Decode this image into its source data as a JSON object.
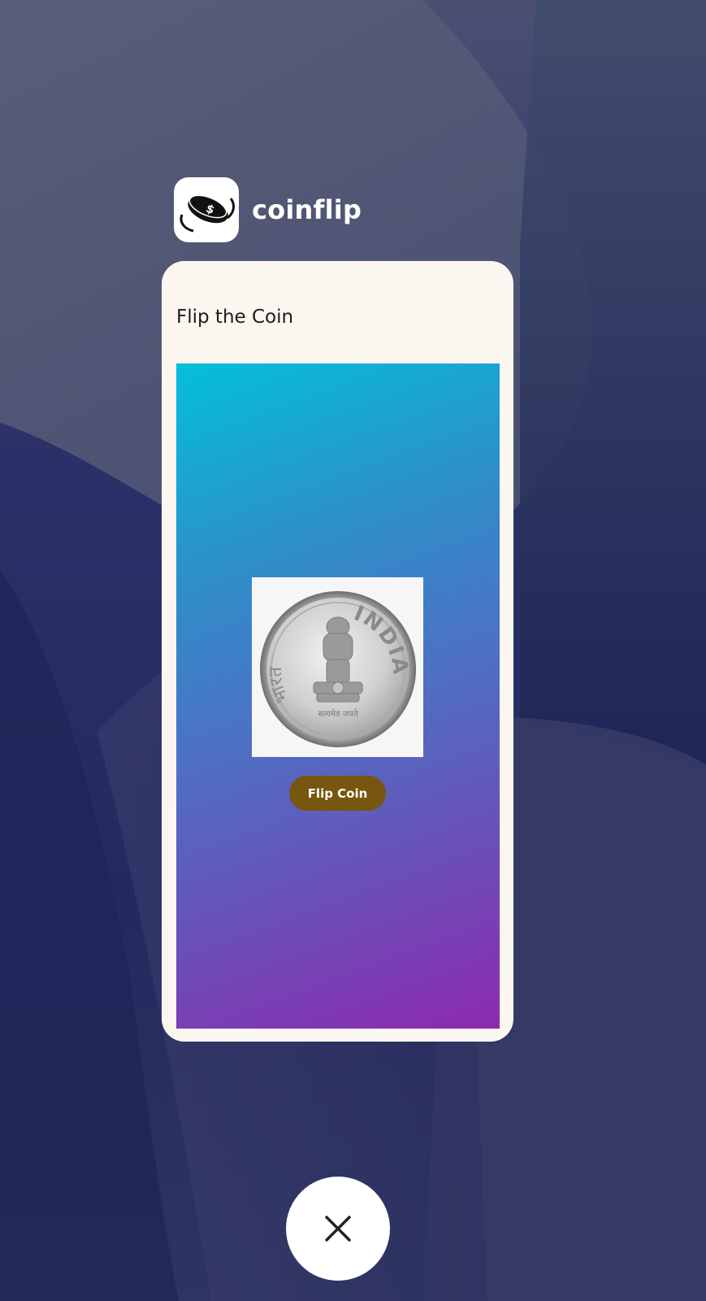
{
  "app": {
    "name": "coinflip",
    "icon": "coin-dollar-icon"
  },
  "screen": {
    "title": "Flip the Coin",
    "coin_image": "indian-one-rupee-coin",
    "coin_text": "INDIA",
    "flip_button_label": "Flip Coin"
  },
  "recents": {
    "close_icon": "close-icon"
  },
  "colors": {
    "card_background": "#fcf6f1",
    "gradient_start": "#04bfd9",
    "gradient_end": "#8d2aae",
    "button_background": "#77560f",
    "button_text": "#ffffff"
  }
}
